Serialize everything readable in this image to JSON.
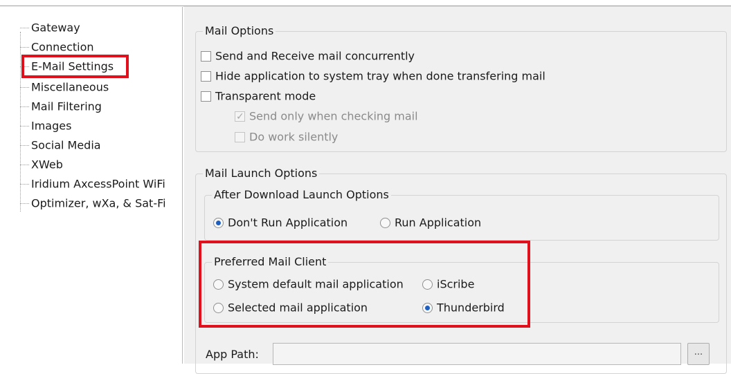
{
  "tree": {
    "items": [
      {
        "label": "Gateway"
      },
      {
        "label": "Connection"
      },
      {
        "label": "E-Mail Settings"
      },
      {
        "label": "Miscellaneous"
      },
      {
        "label": "Mail Filtering"
      },
      {
        "label": "Images"
      },
      {
        "label": "Social Media"
      },
      {
        "label": "XWeb"
      },
      {
        "label": "Iridium AxcessPoint WiFi"
      },
      {
        "label": "Optimizer, wXa, & Sat-Fi"
      }
    ],
    "selected": "E-Mail Settings"
  },
  "mail_options": {
    "title": "Mail Options",
    "send_receive_concurrently": {
      "label": "Send and Receive mail concurrently",
      "checked": false
    },
    "hide_to_tray": {
      "label": "Hide application to system tray when done transfering mail",
      "checked": false
    },
    "transparent_mode": {
      "label": "Transparent mode",
      "checked": false
    },
    "send_only_when_checking": {
      "label": "Send only when checking mail",
      "checked": true,
      "enabled": false
    },
    "do_work_silently": {
      "label": "Do work silently",
      "checked": false,
      "enabled": false
    }
  },
  "mail_launch_options": {
    "title": "Mail Launch Options",
    "after_download": {
      "title": "After Download Launch Options",
      "dont_run": {
        "label": "Don't Run Application",
        "selected": true
      },
      "run": {
        "label": "Run Application",
        "selected": false
      }
    },
    "preferred_client": {
      "title": "Preferred Mail Client",
      "system_default": {
        "label": "System default mail application",
        "selected": false
      },
      "iscribe": {
        "label": "iScribe",
        "selected": false
      },
      "selected_app": {
        "label": "Selected mail application",
        "selected": false
      },
      "thunderbird": {
        "label": "Thunderbird",
        "selected": true
      }
    },
    "app_path": {
      "label": "App Path:",
      "value": "",
      "browse_label": "..."
    }
  },
  "colors": {
    "highlight_box": "#e0101c",
    "radio_dot": "#1f5fbf"
  }
}
